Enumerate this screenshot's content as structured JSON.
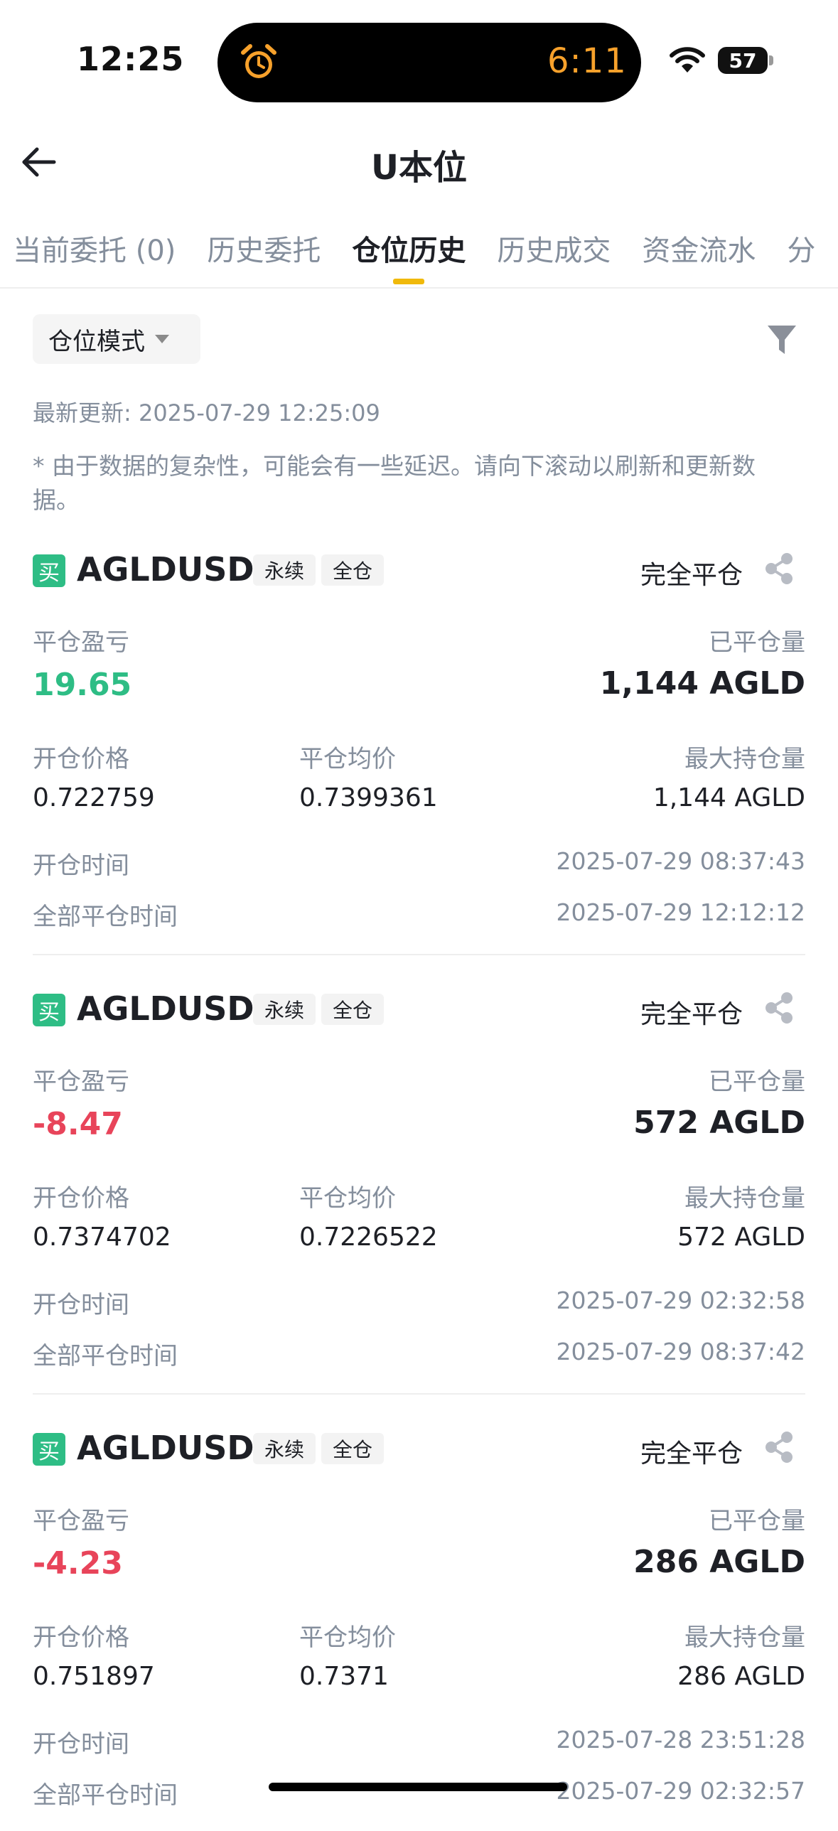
{
  "status_bar": {
    "time": "12:25",
    "island_time": "6:11",
    "battery": "57"
  },
  "header": {
    "title": "U本位"
  },
  "tabs": [
    {
      "label": "当前委托 (0)"
    },
    {
      "label": "历史委托"
    },
    {
      "label": "仓位历史"
    },
    {
      "label": "历史成交"
    },
    {
      "label": "资金流水"
    },
    {
      "label": "分"
    }
  ],
  "filter": {
    "mode_label": "仓位模式"
  },
  "updated": "最新更新: 2025-07-29 12:25:09",
  "note": "* 由于数据的复杂性，可能会有一些延迟。请向下滚动以刷新和更新数据。",
  "labels": {
    "pnl": "平仓盈亏",
    "closed_qty": "已平仓量",
    "open_price": "开仓价格",
    "avg_close": "平仓均价",
    "max_qty": "最大持仓量",
    "open_time": "开仓时间",
    "close_time": "全部平仓时间"
  },
  "positions": [
    {
      "badge": "买",
      "symbol": "AGLDUSDT",
      "tag1": "永续",
      "tag2": "全仓",
      "status": "完全平仓",
      "pnl": "19.65",
      "pnl_color": "#2ebd85",
      "closed_qty": "1,144 AGLD",
      "open_price": "0.722759",
      "avg_close": "0.7399361",
      "max_qty": "1,144 AGLD",
      "open_time": "2025-07-29 08:37:43",
      "close_time": "2025-07-29 12:12:12"
    },
    {
      "badge": "买",
      "symbol": "AGLDUSDT",
      "tag1": "永续",
      "tag2": "全仓",
      "status": "完全平仓",
      "pnl": "-8.47",
      "pnl_color": "#e8445a",
      "closed_qty": "572 AGLD",
      "open_price": "0.7374702",
      "avg_close": "0.7226522",
      "max_qty": "572 AGLD",
      "open_time": "2025-07-29 02:32:58",
      "close_time": "2025-07-29 08:37:42"
    },
    {
      "badge": "买",
      "symbol": "AGLDUSDT",
      "tag1": "永续",
      "tag2": "全仓",
      "status": "完全平仓",
      "pnl": "-4.23",
      "pnl_color": "#e8445a",
      "closed_qty": "286 AGLD",
      "open_price": "0.751897",
      "avg_close": "0.7371",
      "max_qty": "286 AGLD",
      "open_time": "2025-07-28 23:51:28",
      "close_time": "2025-07-29 02:32:57"
    }
  ],
  "icons": {
    "back": "arrow-left-icon",
    "filter": "funnel-icon",
    "share": "share-icon",
    "alarm": "alarm-clock-icon",
    "wifi": "wifi-icon"
  }
}
